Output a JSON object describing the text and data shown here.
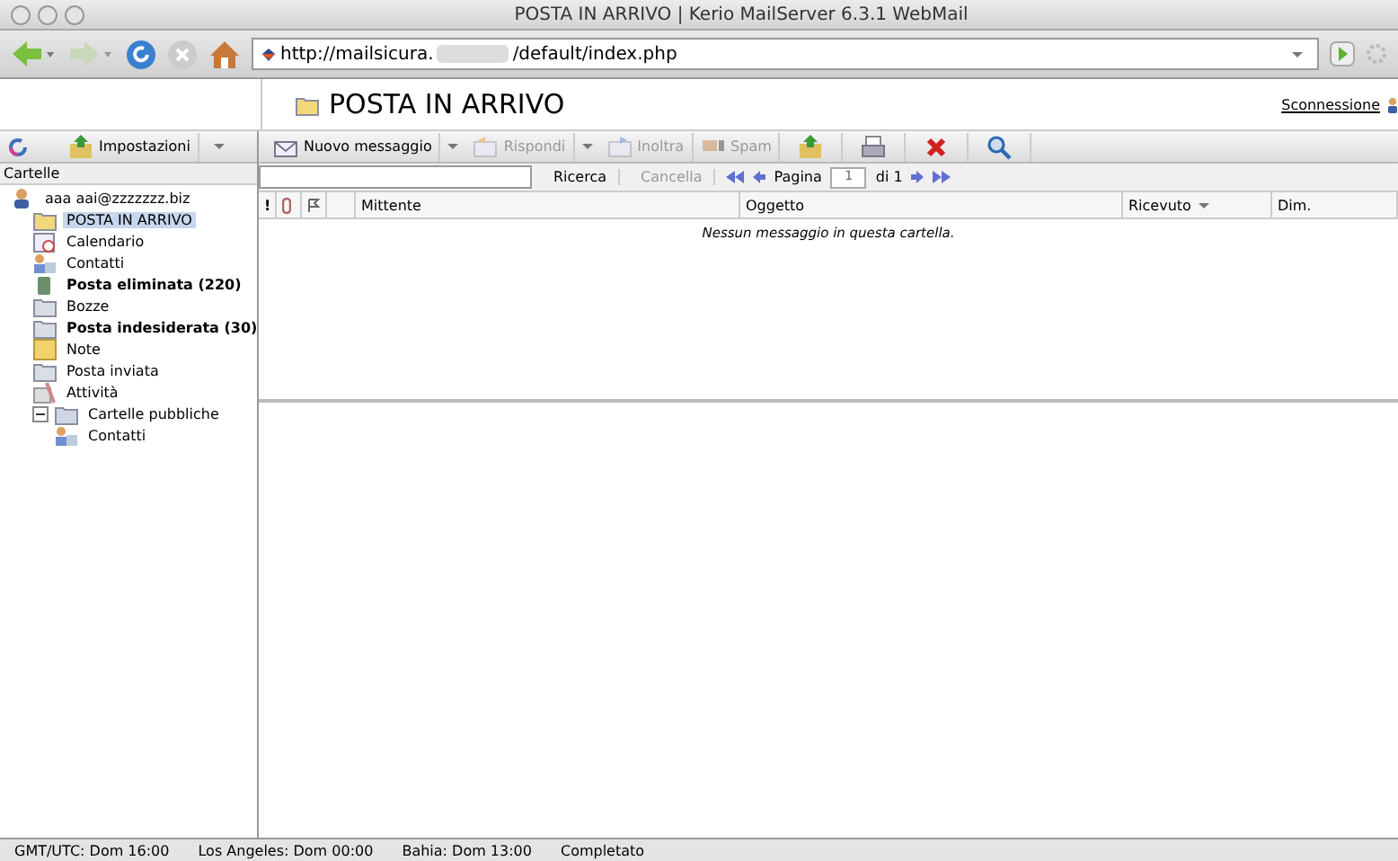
{
  "window": {
    "title": "POSTA IN ARRIVO | Kerio MailServer 6.3.1 WebMail"
  },
  "browser": {
    "url_start": "http://mailsicura.",
    "url_end": "/default/index.php"
  },
  "header": {
    "title": "POSTA IN ARRIVO",
    "logout": "Sconnessione"
  },
  "sidebar_toolbar": {
    "settings": "Impostazioni"
  },
  "sidebar": {
    "heading": "Cartelle",
    "tree": [
      {
        "label": "aaa aai@zzzzzzz.biz",
        "kind": "account",
        "selected": false,
        "unread": false,
        "children": [
          {
            "label": "POSTA IN ARRIVO",
            "kind": "inbox",
            "selected": true,
            "unread": false
          },
          {
            "label": "Calendario",
            "kind": "calendar",
            "selected": false,
            "unread": false
          },
          {
            "label": "Contatti",
            "kind": "contacts",
            "selected": false,
            "unread": false
          },
          {
            "label": "Posta eliminata (220)",
            "kind": "trash",
            "selected": false,
            "unread": true
          },
          {
            "label": "Bozze",
            "kind": "folder",
            "selected": false,
            "unread": false
          },
          {
            "label": "Posta indesiderata (30)",
            "kind": "folder",
            "selected": false,
            "unread": true
          },
          {
            "label": "Note",
            "kind": "notes",
            "selected": false,
            "unread": false
          },
          {
            "label": "Posta inviata",
            "kind": "folder",
            "selected": false,
            "unread": false
          },
          {
            "label": "Attività",
            "kind": "tasks",
            "selected": false,
            "unread": false
          },
          {
            "label": "Cartelle pubbliche",
            "kind": "public",
            "selected": false,
            "unread": false,
            "expanded": true,
            "children": [
              {
                "label": "Contatti",
                "kind": "contacts",
                "selected": false,
                "unread": false
              }
            ]
          }
        ]
      }
    ]
  },
  "toolbar": [
    {
      "label": "Nuovo messaggio",
      "kind": "new",
      "disabled": false,
      "dropdown": true
    },
    {
      "label": "Rispondi",
      "kind": "reply",
      "disabled": true,
      "dropdown": true
    },
    {
      "label": "Inoltra",
      "kind": "forward",
      "disabled": true
    },
    {
      "label": "Spam",
      "kind": "spam",
      "disabled": true
    },
    {
      "kind": "move",
      "disabled": false
    },
    {
      "kind": "print",
      "disabled": false
    },
    {
      "kind": "delete",
      "disabled": false
    },
    {
      "kind": "search",
      "disabled": false
    }
  ],
  "search": {
    "button": "Ricerca",
    "clear": "Cancella",
    "page_label": "Pagina",
    "page": "1",
    "page_total": "di 1"
  },
  "table": {
    "columns": [
      {
        "kind": "priority",
        "label": "!"
      },
      {
        "kind": "attachment"
      },
      {
        "kind": "flag"
      },
      {
        "kind": "blank"
      },
      {
        "kind": "text",
        "label": "Mittente"
      },
      {
        "kind": "text",
        "label": "Oggetto"
      },
      {
        "kind": "sorted",
        "label": "Ricevuto"
      },
      {
        "kind": "text",
        "label": "Dim."
      }
    ],
    "empty_message": "Nessun messaggio in questa cartella."
  },
  "status_bar": [
    "GMT/UTC: Dom 16:00",
    "Los Angeles: Dom 00:00",
    "Bahia: Dom 13:00",
    "Completato"
  ]
}
